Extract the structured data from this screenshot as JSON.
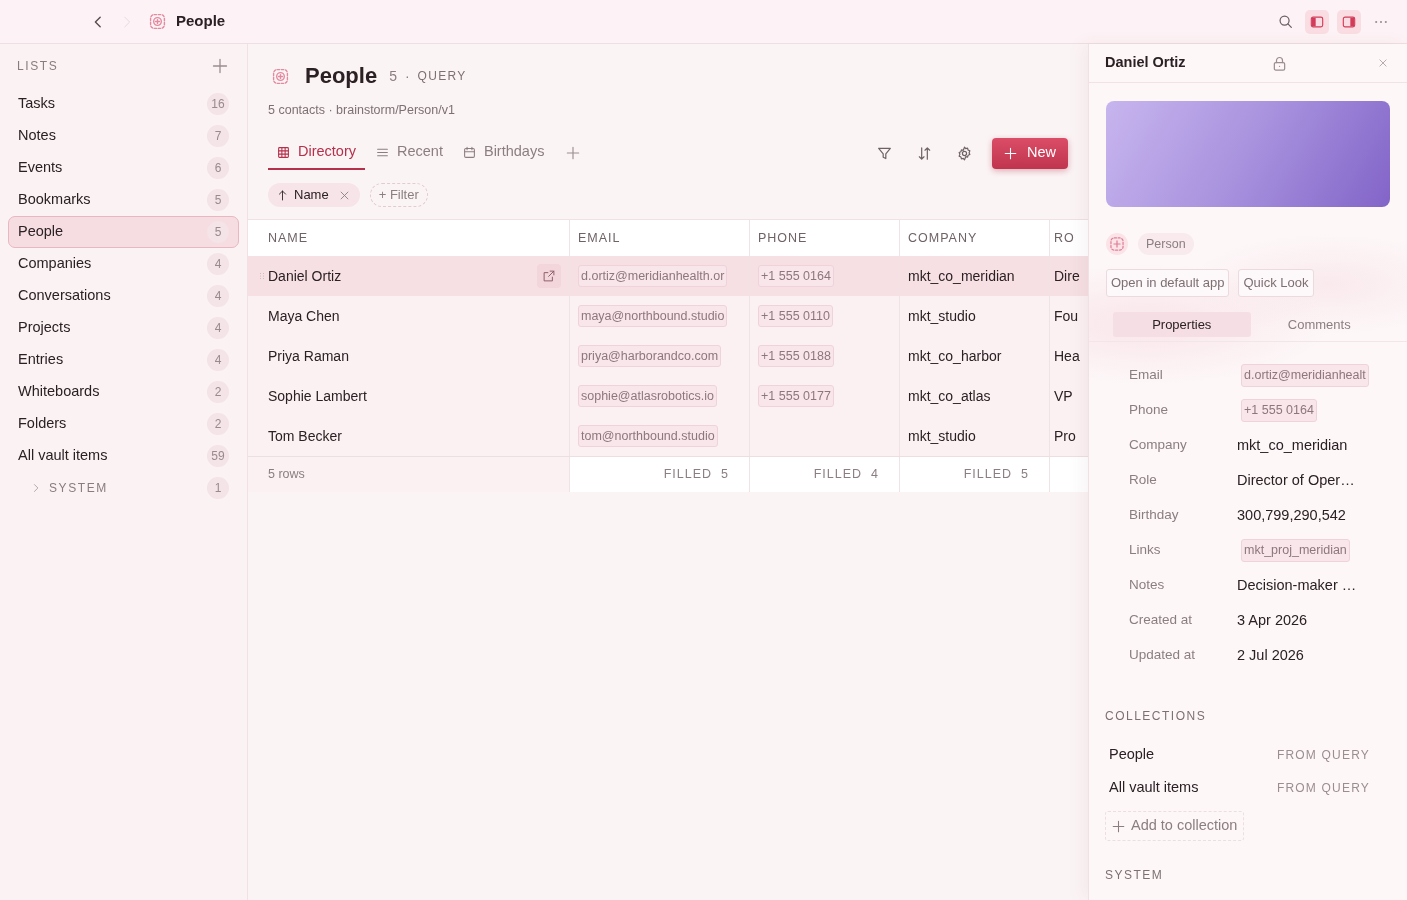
{
  "toolbar": {
    "nav": [
      {
        "kind": "back",
        "disabled": false
      },
      {
        "kind": "forward",
        "disabled": true
      }
    ],
    "title": "People",
    "panel_toggles": [
      {
        "kind": "left",
        "on": true
      },
      {
        "kind": "right",
        "on": true
      }
    ]
  },
  "sidebar": {
    "heading": "LISTS",
    "items": [
      {
        "label": "Tasks",
        "count": "16",
        "selected": false
      },
      {
        "label": "Notes",
        "count": "7",
        "selected": false
      },
      {
        "label": "Events",
        "count": "6",
        "selected": false
      },
      {
        "label": "Bookmarks",
        "count": "5",
        "selected": false
      },
      {
        "label": "People",
        "count": "5",
        "selected": true
      },
      {
        "label": "Companies",
        "count": "4",
        "selected": false
      },
      {
        "label": "Conversations",
        "count": "4",
        "selected": false
      },
      {
        "label": "Projects",
        "count": "4",
        "selected": false
      },
      {
        "label": "Entries",
        "count": "4",
        "selected": false
      },
      {
        "label": "Whiteboards",
        "count": "2",
        "selected": false
      },
      {
        "label": "Folders",
        "count": "2",
        "selected": false
      },
      {
        "label": "All vault items",
        "count": "59",
        "selected": false
      }
    ],
    "system": {
      "label": "SYSTEM",
      "count": "1",
      "expanded": false
    }
  },
  "view": {
    "title": "People",
    "count": "5",
    "separator": "·",
    "source_kind": "QUERY",
    "subtitle": "5 contacts · brainstorm/Person/v1",
    "tabs": [
      {
        "label": "Directory",
        "kind": "grid",
        "selected": true
      },
      {
        "label": "Recent",
        "kind": "list",
        "selected": false
      },
      {
        "label": "Birthdays",
        "kind": "calendar",
        "selected": false
      }
    ],
    "new_button": "New",
    "sort_chip": "Name",
    "filter_button": "+ Filter"
  },
  "table": {
    "columns": [
      {
        "label": "NAME",
        "kind": "text"
      },
      {
        "label": "EMAIL",
        "kind": "chip"
      },
      {
        "label": "PHONE",
        "kind": "chip"
      },
      {
        "label": "COMPANY",
        "kind": "text"
      },
      {
        "label": "RO",
        "kind": "text"
      }
    ],
    "rows": [
      {
        "name": "Daniel Ortiz",
        "email": "d.ortiz@meridianhealth.or",
        "phone": "+1 555 0164",
        "company": "mkt_co_meridian",
        "column_5": "Dire",
        "selected": true
      },
      {
        "name": "Maya Chen",
        "email": "maya@northbound.studio",
        "phone": "+1 555 0110",
        "company": "mkt_studio",
        "column_5": "Fou",
        "selected": false
      },
      {
        "name": "Priya Raman",
        "email": "priya@harborandco.com",
        "phone": "+1 555 0188",
        "company": "mkt_co_harbor",
        "column_5": "Hea",
        "selected": false
      },
      {
        "name": "Sophie Lambert",
        "email": "sophie@atlasrobotics.io",
        "phone": "+1 555 0177",
        "company": "mkt_co_atlas",
        "column_5": "VP",
        "selected": false
      },
      {
        "name": "Tom Becker",
        "email": "tom@northbound.studio",
        "company": "mkt_studio",
        "column_5": "Pro",
        "selected": false
      }
    ],
    "footer": {
      "row_count": "5 rows",
      "filled": [
        {
          "label": "FILLED",
          "count": "5"
        },
        {
          "label": "FILLED",
          "count": "4"
        },
        {
          "label": "FILLED",
          "count": "5"
        }
      ]
    }
  },
  "panel": {
    "title": "Daniel Ortiz",
    "type_label": "Person",
    "actions": [
      "Open in default app",
      "Quick Look"
    ],
    "tabs": [
      {
        "label": "Properties",
        "selected": true
      },
      {
        "label": "Comments",
        "selected": false
      }
    ],
    "properties": [
      {
        "label": "Email",
        "value": "d.ortiz@meridianhealt",
        "kind": "chip"
      },
      {
        "label": "Phone",
        "value": "+1 555 0164",
        "kind": "chip"
      },
      {
        "label": "Company",
        "value": "mkt_co_meridian",
        "kind": "text"
      },
      {
        "label": "Role",
        "value": "Director of Oper…",
        "kind": "text"
      },
      {
        "label": "Birthday",
        "value": "300,799,290,542",
        "kind": "text"
      },
      {
        "label": "Links",
        "value": "mkt_proj_meridian",
        "kind": "chip"
      },
      {
        "label": "Notes",
        "value": "Decision-maker …",
        "kind": "text"
      },
      {
        "label": "Created at",
        "value": "3 Apr 2026",
        "kind": "text"
      },
      {
        "label": "Updated at",
        "value": "2 Jul 2026",
        "kind": "text"
      }
    ],
    "collections_heading": "COLLECTIONS",
    "collections": [
      {
        "name": "People",
        "source": "FROM QUERY"
      },
      {
        "name": "All vault items",
        "source": "FROM QUERY"
      }
    ],
    "add_collection": "Add to collection",
    "system_heading": "SYSTEM"
  }
}
